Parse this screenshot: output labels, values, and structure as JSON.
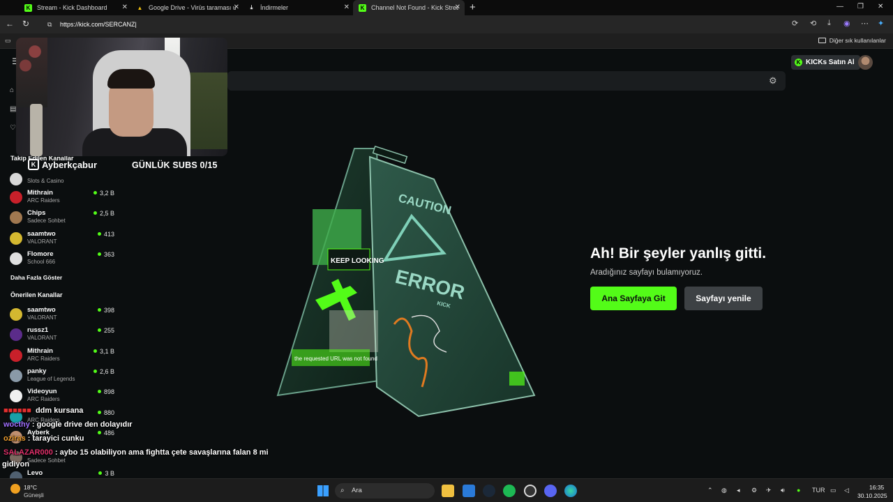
{
  "browser": {
    "tabs": [
      {
        "title": "Stream - Kick Dashboard",
        "favicon": "K",
        "favicon_color": "#53fc18"
      },
      {
        "title": "Google Drive - Virüs taraması uyarısı",
        "favicon": "▲",
        "favicon_color": "#f4c20d"
      },
      {
        "title": "İndirmeler",
        "favicon": "download-icon",
        "favicon_color": "#ffffff"
      },
      {
        "title": "Channel Not Found - Kick Stream",
        "favicon": "K",
        "favicon_color": "#53fc18"
      }
    ],
    "new_tab": "+",
    "url": "https://kick.com/SERCANZ",
    "bookmarks_other": "Diğer sık kullanılanlar"
  },
  "kick": {
    "buy_kicks": "KICKs Satın Al",
    "following_title": "Takip Edilen Kanallar",
    "following": [
      {
        "name": "Mithrain",
        "category": "ARC Raiders",
        "viewers": "3,2 B",
        "avatar_color": "#c8202a"
      },
      {
        "name": "Chips",
        "category": "Sadece Sohbet",
        "viewers": "2,5 B",
        "avatar_color": "#a07850"
      },
      {
        "name": "saamtwo",
        "category": "VALORANT",
        "viewers": "413",
        "avatar_color": "#d4b830"
      },
      {
        "name": "Flomore",
        "category": "School 666",
        "viewers": "363",
        "avatar_color": "#e0e0e0"
      }
    ],
    "first_channel_category": "Slots & Casino",
    "show_more": "Daha Fazla Göster",
    "recommended_title": "Önerilen Kanallar",
    "recommended": [
      {
        "name": "saamtwo",
        "category": "VALORANT",
        "viewers": "398",
        "avatar_color": "#d4b830"
      },
      {
        "name": "russz1",
        "category": "VALORANT",
        "viewers": "255",
        "avatar_color": "#5b2c8a"
      },
      {
        "name": "Mithrain",
        "category": "ARC Raiders",
        "viewers": "3,1 B",
        "avatar_color": "#c8202a"
      },
      {
        "name": "panky",
        "category": "League of Legends",
        "viewers": "2,6 B",
        "avatar_color": "#8a9aa8"
      },
      {
        "name": "Videoyun",
        "category": "ARC Raiders",
        "viewers": "898",
        "avatar_color": "#f0f0f0"
      },
      {
        "name": "",
        "category": "ARC Raiders",
        "viewers": "880",
        "avatar_color": "#18a0a8"
      },
      {
        "name": "Ayberk",
        "category": "",
        "viewers": "486",
        "avatar_color": "#c09070"
      },
      {
        "name": "",
        "category": "Sadece Sohbet",
        "viewers": "",
        "avatar_color": "#7a6a60"
      },
      {
        "name": "Levo",
        "category": "",
        "viewers": "3 B",
        "avatar_color": "#506070"
      }
    ],
    "error_title": "Ah! Bir şeyler yanlış gitti.",
    "error_subtitle": "Aradığınız sayfayı bulamıyoruz.",
    "btn_home": "Ana Sayfaya Git",
    "btn_refresh": "Sayfayı yenile",
    "sign_text": {
      "caution": "CAUTION",
      "error": "ERROR",
      "brand": "KICK",
      "sticker": "KEEP LOOKING",
      "url_note": "the requested URL was not found"
    }
  },
  "overlay": {
    "streamer": "Ayberkçabur",
    "subs_goal": "GÜNLÜK SUBS 0/15",
    "chat": [
      {
        "user": "",
        "text": "ddm kursana",
        "color": "#e03030"
      },
      {
        "user": "wocthy",
        "text": ": google drive den dolayıdır",
        "color": "#a070ff"
      },
      {
        "user": "oziras",
        "text": ": tarayici cunku",
        "color": "#f0a030"
      },
      {
        "user": "SALAZAR000",
        "text": ": aybo 15 olabiliyon ama fightta çete savaşlarına falan 8 mi",
        "color": "#e0306a"
      },
      {
        "user": "",
        "text": "gidiyon",
        "color": "#ffffff"
      }
    ]
  },
  "taskbar": {
    "weather_temp": "18°C",
    "weather_desc": "Güneşli",
    "search": "Ara",
    "lang": "TUR",
    "time": "16:35",
    "date": "30.10.2025"
  }
}
